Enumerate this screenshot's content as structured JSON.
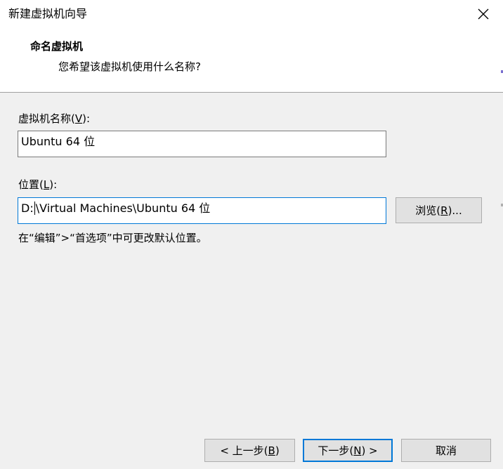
{
  "window": {
    "title": "新建虚拟机向导"
  },
  "header": {
    "title": "命名虚拟机",
    "subtitle": "您希望该虚拟机使用什么名称?"
  },
  "name_field": {
    "label_prefix": "虚拟机名称(",
    "label_key": "V",
    "label_suffix": "):",
    "value": "Ubuntu 64 位"
  },
  "location_field": {
    "label_prefix": "位置(",
    "label_key": "L",
    "label_suffix": "):",
    "value_before_caret": "D:",
    "value_after_caret": "\\Virtual Machines\\Ubuntu 64 位"
  },
  "browse_button": {
    "prefix": "浏览(",
    "key": "R",
    "suffix": ")..."
  },
  "hint": "在“编辑”>“首选项”中可更改默认位置。",
  "footer": {
    "back": {
      "prefix": "< 上一步(",
      "key": "B",
      "suffix": ")"
    },
    "next": {
      "prefix": "下一步(",
      "key": "N",
      "suffix": ") >"
    },
    "cancel": {
      "label": "取消"
    }
  },
  "colors": {
    "accent": "#0078d7",
    "dialog_bg": "#f0f0f0",
    "button_bg": "#e1e1e1"
  },
  "icons": {
    "close": "close-icon"
  }
}
